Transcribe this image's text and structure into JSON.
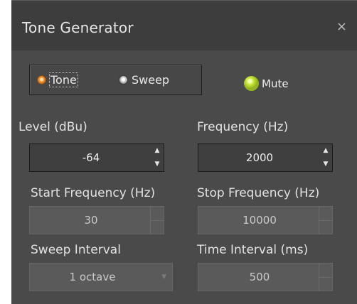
{
  "window": {
    "title": "Tone Generator",
    "close_glyph": "×"
  },
  "mode": {
    "options": [
      {
        "label": "Tone",
        "selected": true
      },
      {
        "label": "Sweep",
        "selected": false
      }
    ]
  },
  "mute": {
    "label": "Mute",
    "indicator_color": "#c8e83a"
  },
  "fields": {
    "level": {
      "label": "Level (dBu)",
      "value": "-64",
      "enabled": true
    },
    "frequency": {
      "label": "Frequency (Hz)",
      "value": "2000",
      "enabled": true
    },
    "start_frequency": {
      "label": "Start Frequency (Hz)",
      "value": "30",
      "enabled": false
    },
    "stop_frequency": {
      "label": "Stop Frequency (Hz)",
      "value": "10000",
      "enabled": false
    },
    "sweep_interval": {
      "label": "Sweep Interval",
      "value": "1 octave",
      "enabled": false
    },
    "time_interval": {
      "label": "Time Interval (ms)",
      "value": "500",
      "enabled": false
    }
  },
  "icons": {
    "spin_up": "▲",
    "spin_down": "▼",
    "dropdown": "▼"
  },
  "colors": {
    "background": "#4a4a4a",
    "titlebar": "#3d3d3d",
    "radio_selected": "#f19a35",
    "text": "#e6e6e6"
  }
}
